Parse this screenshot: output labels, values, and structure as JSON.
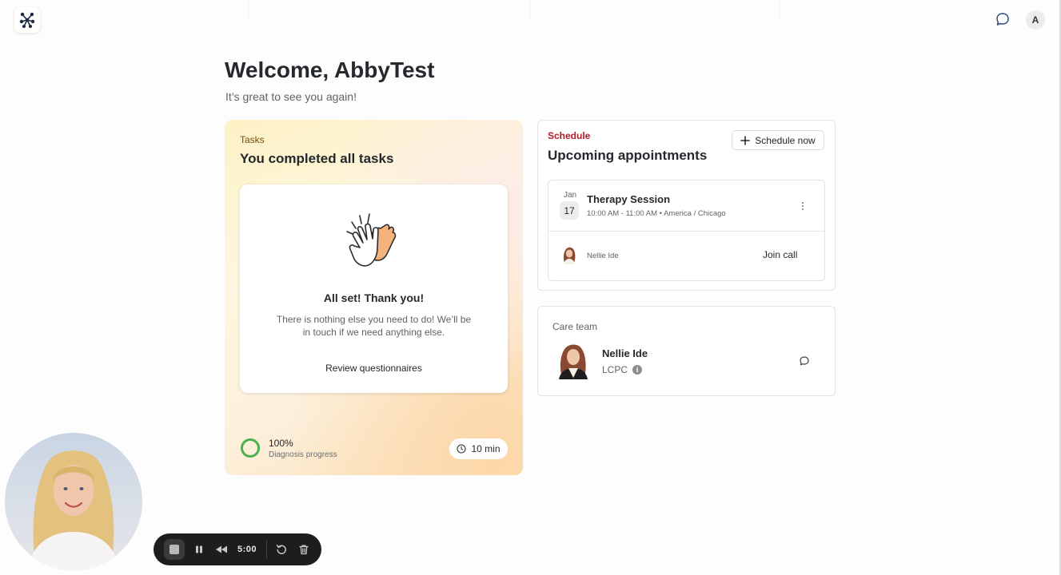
{
  "header": {
    "avatar_initial": "A"
  },
  "welcome": {
    "title": "Welcome, AbbyTest",
    "subtitle": "It’s great to see you again!"
  },
  "tasks": {
    "label": "Tasks",
    "title": "You completed all tasks",
    "done_title": "All set! Thank you!",
    "done_text": "There is nothing else you need to do! We’ll be in touch if we need anything else.",
    "review_label": "Review questionnaires",
    "progress_pct_text": "100%",
    "progress_value": 1.0,
    "progress_label": "Diagnosis progress",
    "duration": "10 min"
  },
  "schedule": {
    "label": "Schedule",
    "title": "Upcoming appointments",
    "schedule_now_label": "Schedule now",
    "appointment": {
      "month": "Jan",
      "day": "17",
      "title": "Therapy Session",
      "time": "10:00 AM - 11:00 AM • America / Chicago",
      "provider": "Nellie Ide",
      "join_label": "Join call"
    }
  },
  "care_team": {
    "label": "Care team",
    "member": {
      "name": "Nellie Ide",
      "credential": "LCPC"
    }
  },
  "recorder": {
    "time": "5:00"
  },
  "colors": {
    "schedule_accent": "#b31d2a",
    "tasks_label": "#7a4f12",
    "progress_ring": "#4caf50",
    "recorder_bg": "#1d1d1f"
  },
  "icons": {
    "logo": "molecule-logo-icon",
    "chat": "chat-bubble-icon",
    "hands": "high-five-icon",
    "clock": "clock-icon",
    "plus": "plus-icon",
    "info": "info-icon"
  }
}
